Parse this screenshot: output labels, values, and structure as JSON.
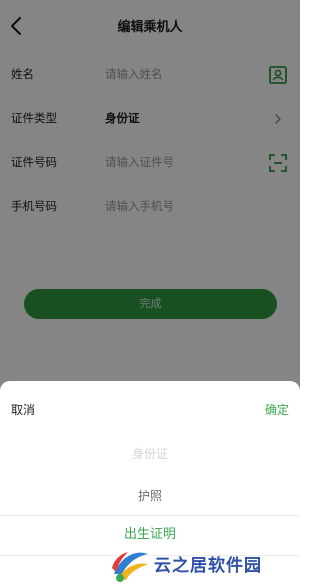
{
  "header": {
    "title": "编辑乘机人",
    "back_icon": "chevron-left-icon"
  },
  "form": {
    "name": {
      "label": "姓名",
      "placeholder": "请输入姓名",
      "icon": "contact-card-icon"
    },
    "id_type": {
      "label": "证件类型",
      "value": "身份证",
      "icon": "chevron-right-icon"
    },
    "id_number": {
      "label": "证件号码",
      "placeholder": "请输入证件号",
      "icon": "scan-icon"
    },
    "phone": {
      "label": "手机号码",
      "placeholder": "请输入手机号"
    }
  },
  "submit_label": "完成",
  "picker": {
    "cancel_label": "取消",
    "confirm_label": "确定",
    "options": [
      "身份证",
      "护照",
      "出生证明"
    ],
    "selected": "出生证明"
  },
  "watermark": {
    "text": "云之居软件园"
  },
  "colors": {
    "accent": "#3aa851",
    "button": "#2f9a42",
    "icon": "#2f9a42",
    "overlay": "rgba(0,0,0,0.48)"
  }
}
